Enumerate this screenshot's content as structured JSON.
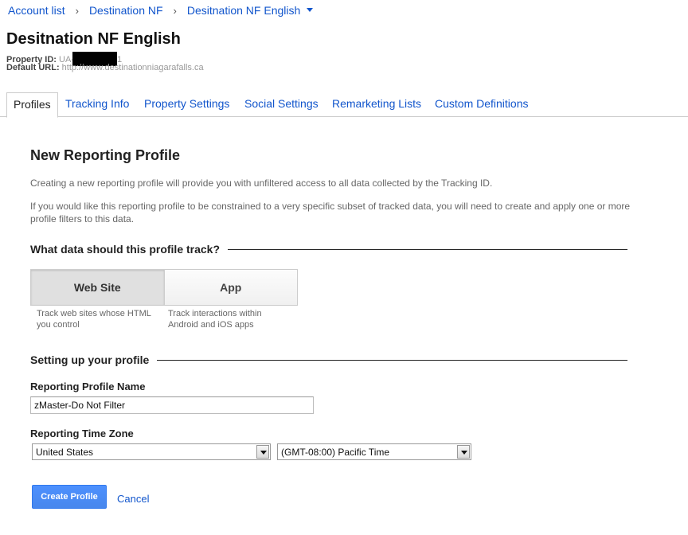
{
  "breadcrumb": {
    "account_list": "Account list",
    "account": "Destination NF",
    "property": "Desitnation NF English"
  },
  "property": {
    "title": "Desitnation NF English",
    "id_label": "Property ID:",
    "id_prefix": "UA-",
    "id_suffix": "1",
    "url_label": "Default URL:",
    "url_value": "http://www.destinationniagarafalls.ca"
  },
  "tabs": [
    {
      "label": "Profiles",
      "active": true
    },
    {
      "label": "Tracking Info"
    },
    {
      "label": "Property Settings"
    },
    {
      "label": "Social Settings"
    },
    {
      "label": "Remarketing Lists"
    },
    {
      "label": "Custom Definitions"
    }
  ],
  "main": {
    "title": "New Reporting Profile",
    "intro_1": "Creating a new reporting profile will provide you with unfiltered access to all data collected by the Tracking ID.",
    "intro_2": "If you would like this reporting profile to be constrained to a very specific subset of tracked data, you will need to create and apply one or more profile filters to this data.",
    "track_heading": "What data should this profile track?",
    "options": {
      "website": {
        "label": "Web Site",
        "desc": "Track web sites whose HTML you control",
        "selected": true
      },
      "app": {
        "label": "App",
        "desc": "Track interactions within Android and iOS apps"
      }
    },
    "setup_heading": "Setting up your profile",
    "name_label": "Reporting Profile Name",
    "name_value": "zMaster-Do Not Filter",
    "tz_label": "Reporting Time Zone",
    "country_value": "United States",
    "tz_value": "(GMT-08:00) Pacific Time",
    "create_label": "Create Profile",
    "cancel_label": "Cancel"
  },
  "colors": {
    "link": "#1155cc",
    "primary_button": "#4d90fe"
  }
}
